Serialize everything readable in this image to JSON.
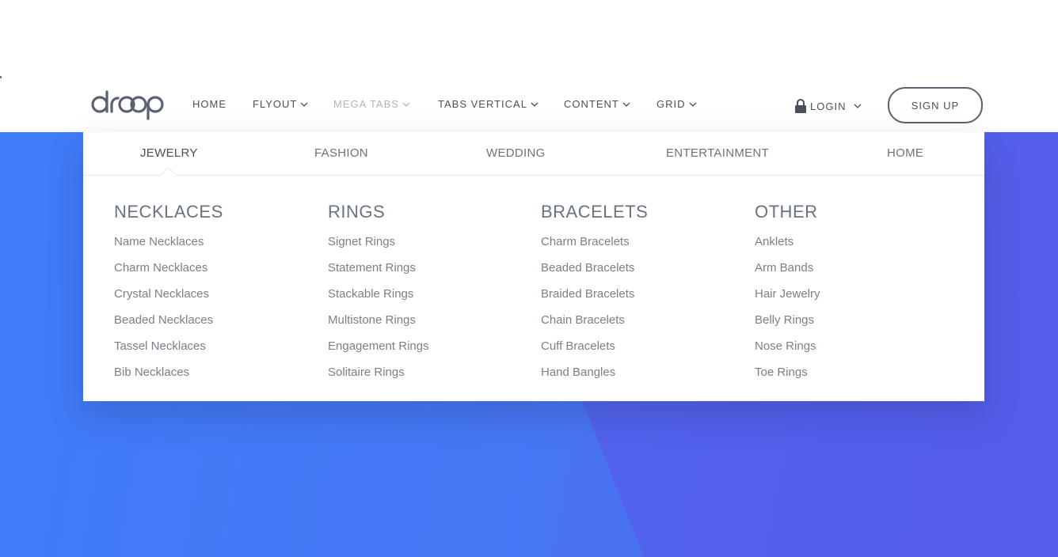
{
  "brand": {
    "logo_text": "droop"
  },
  "nav": {
    "items": [
      {
        "label": "HOME",
        "dropdown": false,
        "active": false
      },
      {
        "label": "FLYOUT",
        "dropdown": true,
        "active": false
      },
      {
        "label": "MEGA TABS",
        "dropdown": true,
        "active": true
      },
      {
        "label": "TABS VERTICAL",
        "dropdown": true,
        "active": false
      },
      {
        "label": "CONTENT",
        "dropdown": true,
        "active": false
      },
      {
        "label": "GRID",
        "dropdown": true,
        "active": false
      }
    ],
    "login": {
      "label": "LOGIN",
      "icon": "lock-icon"
    },
    "signup": {
      "label": "SIGN UP"
    }
  },
  "mega": {
    "tabs": [
      {
        "label": "JEWELRY",
        "active": true
      },
      {
        "label": "FASHION",
        "active": false
      },
      {
        "label": "WEDDING",
        "active": false
      },
      {
        "label": "ENTERTAINMENT",
        "active": false
      },
      {
        "label": "HOME",
        "active": false
      }
    ],
    "columns": [
      {
        "title": "NECKLACES",
        "links": [
          "Name Necklaces",
          "Charm Necklaces",
          "Crystal Necklaces",
          "Beaded Necklaces",
          "Tassel Necklaces",
          "Bib Necklaces"
        ]
      },
      {
        "title": "RINGS",
        "links": [
          "Signet Rings",
          "Statement Rings",
          "Stackable Rings",
          "Multistone Rings",
          "Engagement Rings",
          "Solitaire Rings"
        ]
      },
      {
        "title": "BRACELETS",
        "links": [
          "Charm Bracelets",
          "Beaded Bracelets",
          "Braided Bracelets",
          "Chain Bracelets",
          "Cuff Bracelets",
          "Hand Bangles"
        ]
      },
      {
        "title": "OTHER",
        "links": [
          "Anklets",
          "Arm Bands",
          "Hair Jewelry",
          "Belly Rings",
          "Nose Rings",
          "Toe Rings"
        ]
      }
    ]
  },
  "colors": {
    "hero_start": "#3f7cf8",
    "hero_end": "#5361ea",
    "nav_text": "#4a5058",
    "nav_active": "#aeb6c1",
    "menu_text": "#7a8089"
  }
}
